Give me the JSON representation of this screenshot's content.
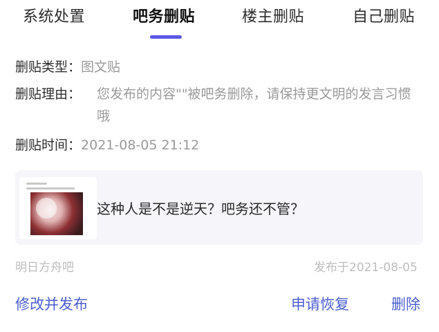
{
  "tabs": [
    {
      "label": "系统处置"
    },
    {
      "label": "吧务删贴"
    },
    {
      "label": "楼主删贴"
    },
    {
      "label": "自己删贴"
    }
  ],
  "active_tab": 1,
  "details": {
    "type_label": "删贴类型：",
    "type_value": "图文贴",
    "reason_label": "删贴理由：",
    "reason_value": "您发布的内容\"\"被吧务删除，请保持更文明的发言习惯哦",
    "time_label": "删贴时间：",
    "time_value": "2021-08-05 21:12"
  },
  "post": {
    "text": "这种人是不是逆天？吧务还不管？",
    "forum": "明日方舟吧",
    "published": "发布于2021-08-05"
  },
  "actions": {
    "edit_publish": "修改并发布",
    "appeal": "申请恢复",
    "delete": "删除"
  },
  "colors": {
    "accent": "#5b57e6",
    "link": "#4b5ed0"
  }
}
